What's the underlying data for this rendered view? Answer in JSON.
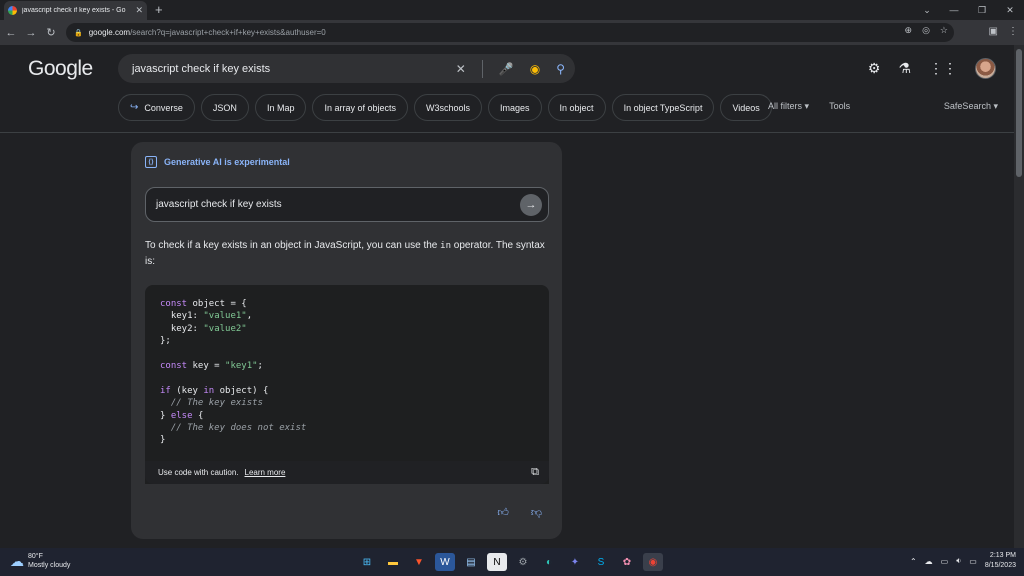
{
  "browser": {
    "tab_title": "javascript check if key exists - Go",
    "url_host": "google.com",
    "url_path": "/search?q=javascript+check+if+key+exists&authuser=0"
  },
  "google": {
    "logo": "Google",
    "query": "javascript check if key exists"
  },
  "chips": [
    "Converse",
    "JSON",
    "In Map",
    "In array of objects",
    "W3schools",
    "Images",
    "In object",
    "In object TypeScript",
    "Videos"
  ],
  "filters": {
    "all_filters": "All filters",
    "tools": "Tools",
    "safesearch": "SafeSearch"
  },
  "sge": {
    "heading": "Generative AI is experimental",
    "followup_value": "javascript check if key exists",
    "answer_pre": "To check if a key exists in an object in JavaScript, you can use the ",
    "answer_code": "in",
    "answer_post": " operator. The syntax is:",
    "code_lines": [
      [
        {
          "t": "const",
          "c": "kw"
        },
        {
          "t": " object = {"
        }
      ],
      [
        {
          "t": "  key1: "
        },
        {
          "t": "\"value1\"",
          "c": "str"
        },
        {
          "t": ","
        }
      ],
      [
        {
          "t": "  key2: "
        },
        {
          "t": "\"value2\"",
          "c": "str"
        }
      ],
      [
        {
          "t": "};"
        }
      ],
      [
        {
          "t": ""
        }
      ],
      [
        {
          "t": "const",
          "c": "kw"
        },
        {
          "t": " key = "
        },
        {
          "t": "\"key1\"",
          "c": "str"
        },
        {
          "t": ";"
        }
      ],
      [
        {
          "t": ""
        }
      ],
      [
        {
          "t": "if",
          "c": "kw"
        },
        {
          "t": " (key "
        },
        {
          "t": "in",
          "c": "kw"
        },
        {
          "t": " object) {"
        }
      ],
      [
        {
          "t": "  // The key exists",
          "c": "cm"
        }
      ],
      [
        {
          "t": "} "
        },
        {
          "t": "else",
          "c": "kw"
        },
        {
          "t": " {"
        }
      ],
      [
        {
          "t": "  // The key does not exist",
          "c": "cm"
        }
      ],
      [
        {
          "t": "}"
        }
      ]
    ],
    "caution": "Use code with caution.",
    "learn_more": "Learn more"
  },
  "taskbar": {
    "temp": "80°F",
    "condition": "Mostly cloudy",
    "time": "2:13 PM",
    "date": "8/15/2023"
  },
  "colors": {
    "accent": "#8ab4f8",
    "background": "#202124",
    "surface": "#303134"
  }
}
